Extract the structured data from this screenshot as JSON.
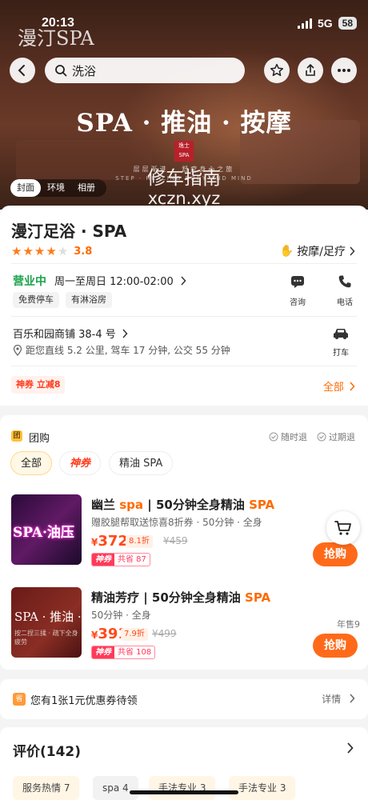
{
  "status_bar": {
    "time": "20:13",
    "network": "5G",
    "battery": "58"
  },
  "hero": {
    "overlay_brand": "漫汀SPA",
    "search_text": "洗浴",
    "title": "SPA · 推油 · 按摩",
    "seal_text": "逸士 SPA",
    "subtitle": "层层渐进 · 舒疗身心之旅",
    "subtitle_en": "STEP · HEALING BODY AND MIND",
    "watermark": "修车指南",
    "watermark_url": "xczn.xyz",
    "tabs": [
      "封面",
      "环境",
      "相册"
    ]
  },
  "shop": {
    "name": "漫汀足浴 · SPA",
    "rating": "3.8",
    "stars": 4,
    "category": "按摩/足疗",
    "open_status": "营业中",
    "hours": "周一至周日 12:00-02:00",
    "tags": [
      "免费停车",
      "有淋浴房"
    ],
    "consult_label": "咨询",
    "phone_label": "电话",
    "address": "百乐和园商铺 38-4 号",
    "distance": "距您直线 5.2 公里, 驾车 17 分钟, 公交 55 分钟",
    "taxi_label": "打车",
    "coupon": "神券 立减8",
    "all_link": "全部"
  },
  "group_buy": {
    "icon_text": "团",
    "title": "团购",
    "guarantees": [
      "随时退",
      "过期退"
    ],
    "filters": [
      "全部",
      "神券",
      "精油 SPA"
    ],
    "deals": [
      {
        "thumb_text": "SPA·油压",
        "thumb_sub": "",
        "title_a": "幽兰 ",
        "title_hl1": "spa",
        "title_b": " | 50分钟全身精油 ",
        "title_hl2": "SPA",
        "meta": "赠胶腿帮取送惊喜8折券 · 50分钟 · 全身",
        "currency": "¥",
        "price": "372",
        "discount": "8.1折",
        "original": "¥459",
        "save_label": "神券",
        "save_amount": "共省 87",
        "button": "抢购",
        "yearsale": ""
      },
      {
        "thumb_text": "SPA · 推油 ·",
        "thumb_sub": "按二捏三揉 · 疏下全身疲劳",
        "title_a": "精油芳疗 | 50分钟全身精油 ",
        "title_hl1": "",
        "title_b": "",
        "title_hl2": "SPA",
        "meta": "50分钟 · 全身",
        "currency": "¥",
        "price": "391",
        "discount": "7.9折",
        "original": "¥499",
        "save_label": "神券",
        "save_amount": "共省 108",
        "button": "抢购",
        "yearsale": "年售9"
      }
    ]
  },
  "voucher": {
    "icon_text": "省",
    "text": "您有1张1元优惠券待领",
    "link": "详情"
  },
  "reviews": {
    "title": "评价(142)",
    "tags": [
      "服务热情 7",
      "spa 4",
      "手法专业 3",
      "手法专业 3"
    ]
  },
  "colors": {
    "accent": "#ff6a1a",
    "open_green": "#1aa34a",
    "coupon_red": "#ff3a1a"
  }
}
